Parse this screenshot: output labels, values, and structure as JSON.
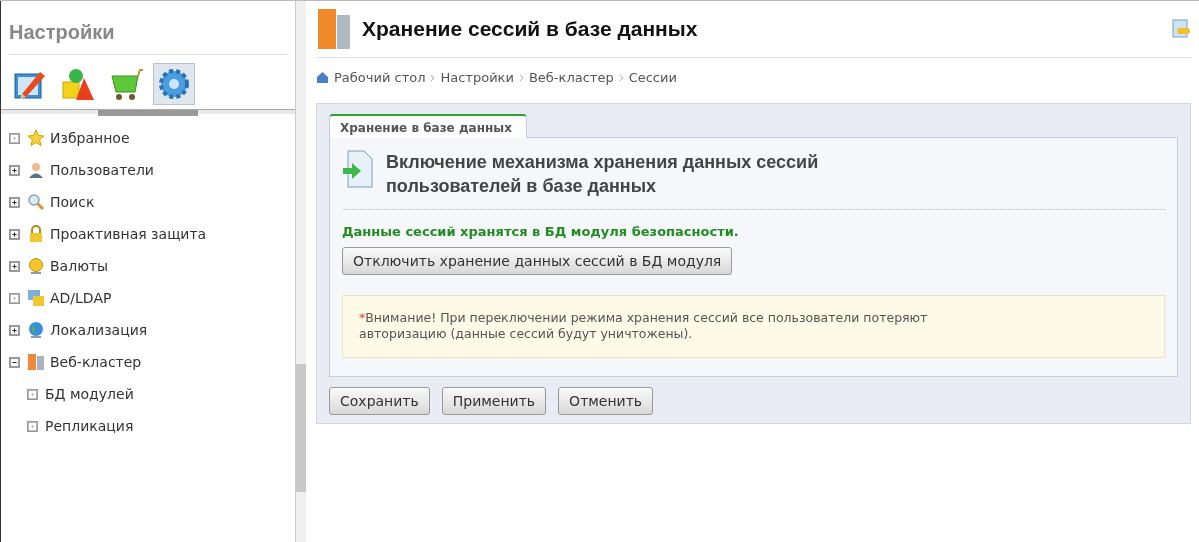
{
  "sidebar": {
    "title": "Настройки",
    "toolbar": [
      {
        "kind": "pencil",
        "selected": false
      },
      {
        "kind": "shapes",
        "selected": false
      },
      {
        "kind": "cart",
        "selected": false
      },
      {
        "kind": "gear",
        "selected": true
      }
    ],
    "items": [
      {
        "label": "Избранное",
        "kind": "leaf"
      },
      {
        "label": "Пользователи",
        "kind": "folder",
        "expanded": false
      },
      {
        "label": "Поиск",
        "kind": "folder",
        "expanded": false
      },
      {
        "label": "Проактивная защита",
        "kind": "folder",
        "expanded": false
      },
      {
        "label": "Валюты",
        "kind": "folder",
        "expanded": false
      },
      {
        "label": "AD/LDAP",
        "kind": "leaf"
      },
      {
        "label": "Локализация",
        "kind": "folder",
        "expanded": false
      },
      {
        "label": "Веб-кластер",
        "kind": "folder",
        "expanded": true,
        "children": [
          {
            "label": "БД модулей",
            "kind": "leaf"
          },
          {
            "label": "Репликация",
            "kind": "leaf"
          }
        ]
      }
    ]
  },
  "page": {
    "title": "Хранение сессий в базе данных",
    "breadcrumbs": [
      "Рабочий стол",
      "Настройки",
      "Веб-кластер",
      "Сессии"
    ],
    "tabs": [
      {
        "label": "Хранение в базе данных",
        "selected": true
      }
    ],
    "section_title": "Включение механизма хранения данных сессий пользователей в базе данных",
    "status": "Данные сессий хранятся в БД модуля безопасности.",
    "action_button": "Отключить хранение данных сессий в БД модуля",
    "warning": {
      "marker": "*",
      "text": "Внимание! При переключении режима хранения сессий все пользователи потеряют авторизацию (данные сессий будут уничтожены)."
    },
    "buttons": [
      "Сохранить",
      "Применить",
      "Отменить"
    ]
  }
}
